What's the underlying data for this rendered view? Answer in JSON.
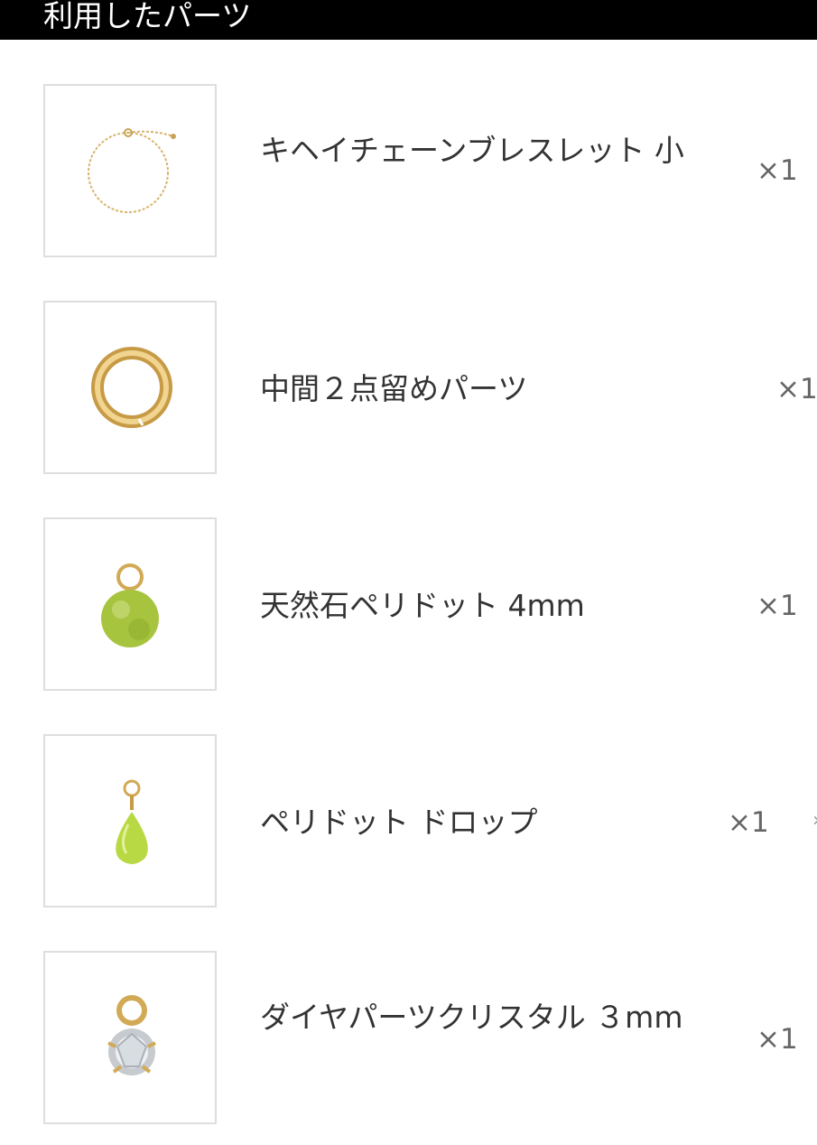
{
  "header": {
    "title": "利用したパーツ"
  },
  "parts": [
    {
      "name": "キヘイチェーンブレスレット 小",
      "qty": "×1",
      "icon": "chain-bracelet-icon"
    },
    {
      "name": "中間２点留めパーツ",
      "qty": "×1",
      "icon": "gold-ring-icon"
    },
    {
      "name": "天然石ペリドット 4mm",
      "qty": "×1",
      "icon": "peridot-bead-icon"
    },
    {
      "name": "ペリドット ドロップ",
      "qty": "×1",
      "icon": "peridot-drop-icon"
    },
    {
      "name": "ダイヤパーツクリスタル ３mm",
      "qty": "×1",
      "icon": "crystal-charm-icon"
    }
  ],
  "colors": {
    "header_bg": "#000000",
    "header_text": "#ffffff",
    "gold": "#d9b46a",
    "peridot": "#a9c94a",
    "thumb_border": "#dedede"
  }
}
